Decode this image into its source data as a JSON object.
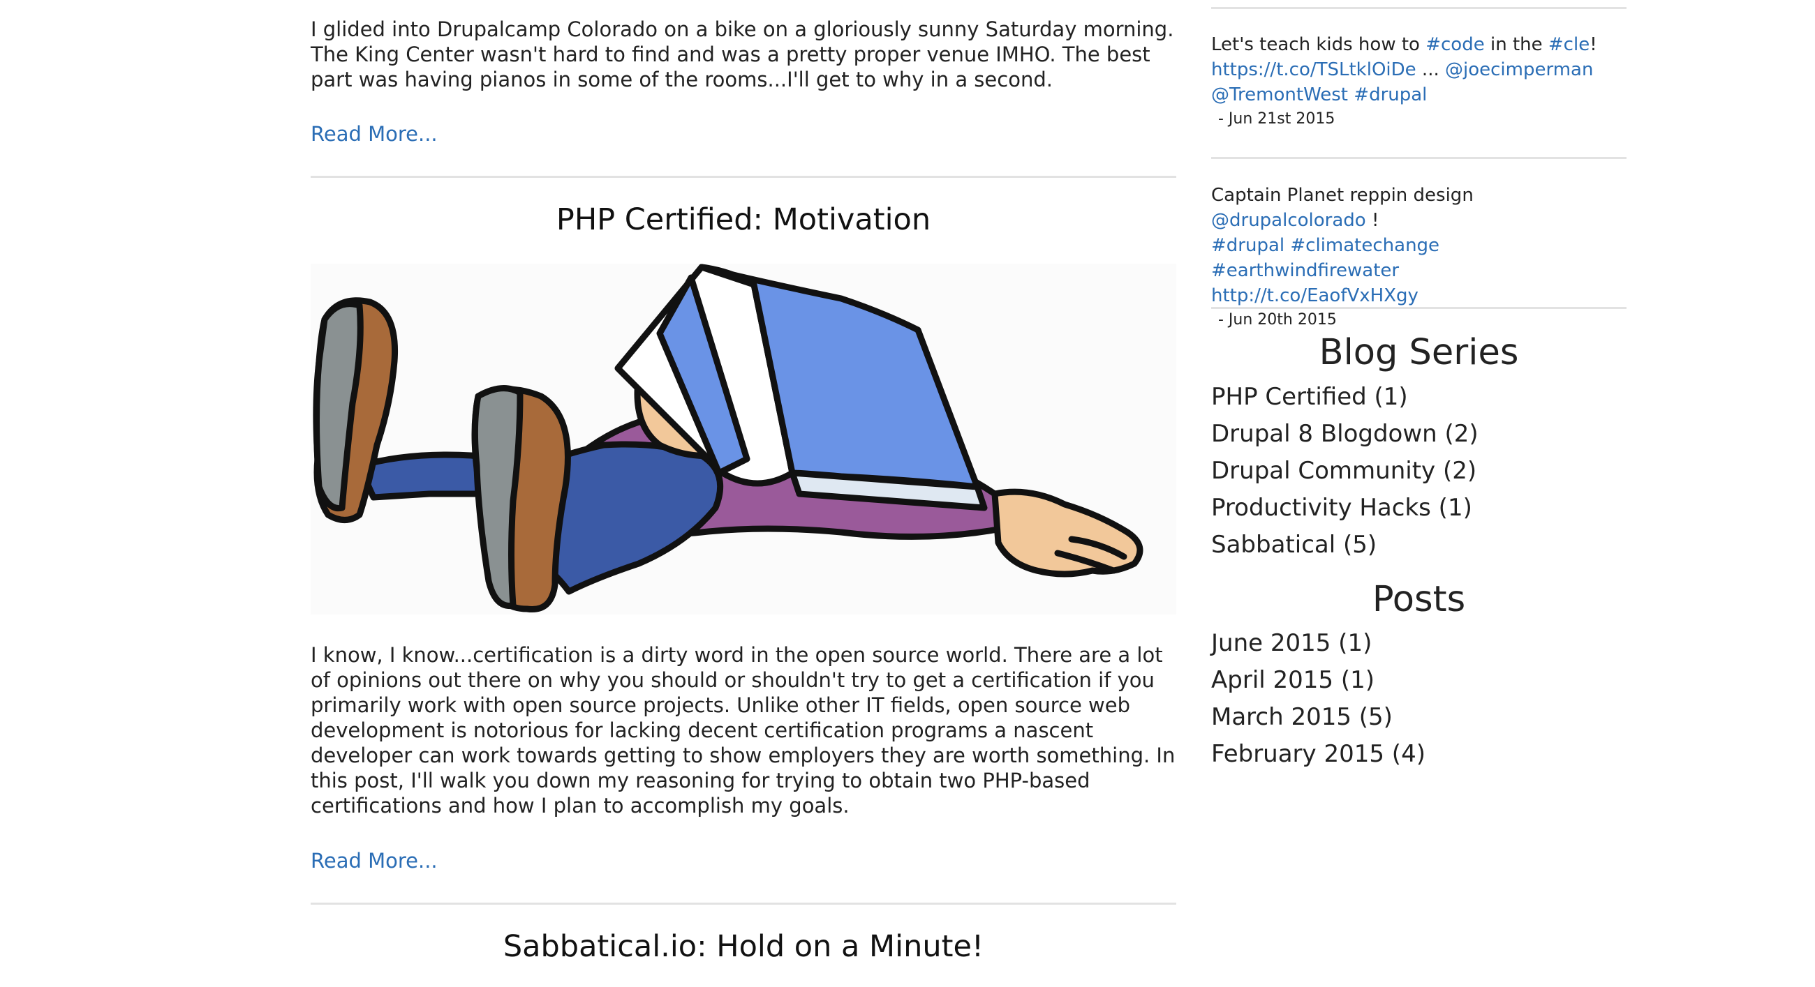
{
  "posts": [
    {
      "excerpt": "I glided into Drupalcamp Colorado on a bike on a gloriously sunny Saturday morning. The King Center wasn't hard to find and was a pretty proper venue IMHO. The best part was having pianos in some of the rooms...I'll get to why in a second.",
      "read_more": "Read More..."
    },
    {
      "title": "PHP Certified: Motivation",
      "image_icon": "cartoon-person-sleeping-under-book",
      "excerpt": "I know, I know...certification is a dirty word in the open source world. There are a lot of opinions out there on why you should or shouldn't try to get a certification if you primarily work with open source projects. Unlike other IT fields, open source web development is notorious for lacking decent certification programs a nascent developer can work towards getting to show employers they are worth something. In this post, I'll walk you down my reasoning for trying to obtain two PHP-based certifications and how I plan to accomplish my goals.",
      "read_more": "Read More..."
    },
    {
      "title": "Sabbatical.io: Hold on a Minute!"
    }
  ],
  "sidebar": {
    "tweets": [
      {
        "t1": "Let's teach kids how to ",
        "l1": "#code",
        "t2": " in the ",
        "l2": "#cle",
        "t3": "!",
        "l3": "https://t.co/TSLtklOiDe",
        "t4": " ... ",
        "l4": "@joecimperman",
        "l5": "@TremontWest",
        "l6": "#drupal",
        "date": "- Jun 21st 2015"
      },
      {
        "t1": "Captain Planet reppin design ",
        "l1": "@drupalcolorado",
        "t2": " !",
        "l2": "#drupal",
        "l3": "#climatechange",
        "l4": "#earthwindfirewater",
        "l5": "http://t.co/EaofVxHXgy",
        "date": "- Jun 20th 2015"
      }
    ],
    "blog_series_heading": "Blog Series",
    "blog_series": [
      "PHP Certified (1)",
      "Drupal 8 Blogdown (2)",
      "Drupal Community (2)",
      "Productivity Hacks (1)",
      "Sabbatical (5)"
    ],
    "posts_heading": "Posts",
    "archive": [
      "June 2015 (1)",
      "April 2015 (1)",
      "March 2015 (5)",
      "February 2015 (4)"
    ]
  },
  "colors": {
    "link": "#2a6db5",
    "text": "#222222",
    "divider": "#e2e2e2"
  }
}
